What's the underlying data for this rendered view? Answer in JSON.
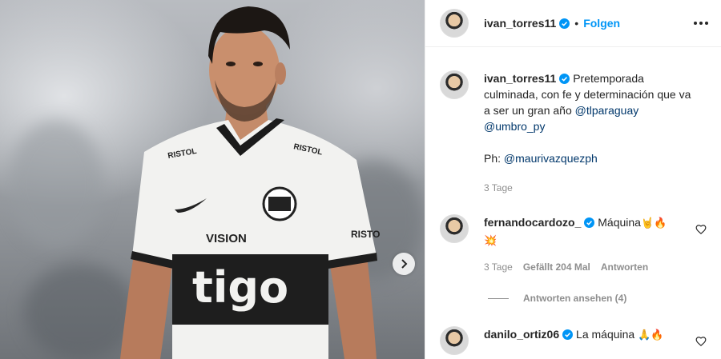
{
  "post": {
    "author": "ivan_torres11",
    "follow_label": "Folgen",
    "caption": {
      "text_1": "Pretemporada culminada, con fe y determinación que va a ser un gran año ",
      "mention_1": "@tlparaguay",
      "mention_2": "@umbro_py",
      "photo_prefix": "Ph: ",
      "mention_3": "@maurivazquezph"
    },
    "age": "3 Tage"
  },
  "jersey": {
    "sponsor_main": "tigo",
    "sponsor_chest": "VISION",
    "brand_left": "RISTOL",
    "brand_right": "RISTOL",
    "sleeve": "RISTO"
  },
  "comments": [
    {
      "user": "fernandocardozo_",
      "text": "Máquina",
      "emojis": "🤘🔥",
      "emoji_line2": "💥",
      "age": "3 Tage",
      "likes": "Gefällt 204 Mal",
      "reply_label": "Antworten",
      "view_replies": "Antworten ansehen (4)"
    },
    {
      "user": "danilo_ortiz06",
      "text": "La máquina",
      "emojis": "🙏🔥"
    }
  ],
  "colors": {
    "link": "#0095f6",
    "mention": "#00376b",
    "muted": "#8e8e8e"
  }
}
